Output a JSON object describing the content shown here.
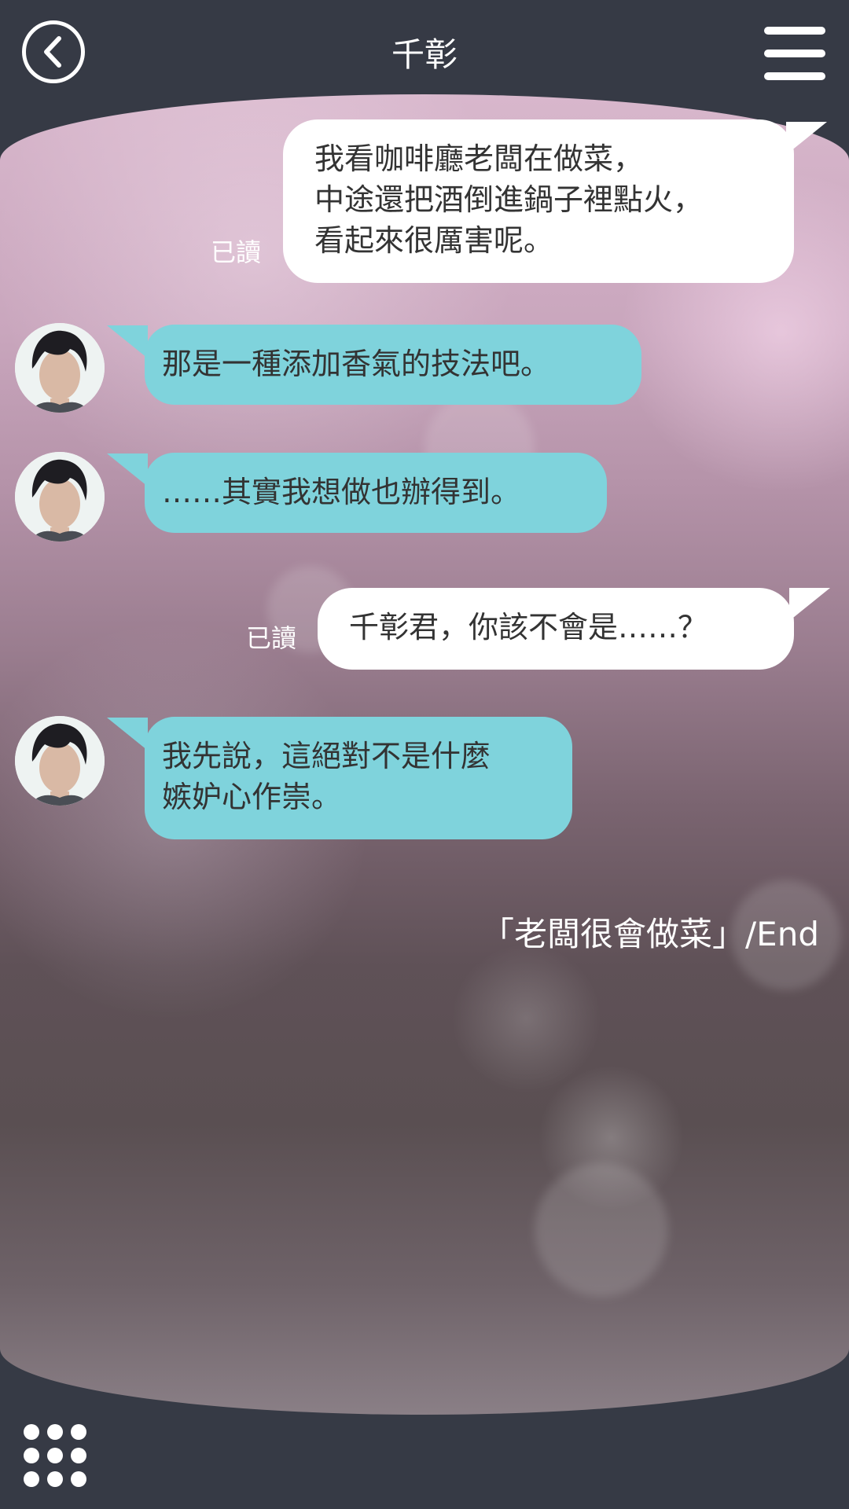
{
  "header": {
    "title": "千彰"
  },
  "messages": [
    {
      "sender": "me",
      "text": "我看咖啡廳老闆在做菜，\n中途還把酒倒進鍋子裡點火，\n看起來很厲害呢。",
      "read": "已讀"
    },
    {
      "sender": "them",
      "text": "那是一種添加香氣的技法吧。"
    },
    {
      "sender": "them",
      "text": "……其實我想做也辦得到。"
    },
    {
      "sender": "me",
      "text": "千彰君，你該不會是……？",
      "read": "已讀"
    },
    {
      "sender": "them",
      "text": "我先說，這絕對不是什麼\n嫉妒心作崇。"
    }
  ],
  "end_caption": "「老闆很會做菜」/End",
  "colors": {
    "chrome": "#363a45",
    "them_bubble": "#7fd3dc",
    "me_bubble": "#ffffff"
  },
  "icons": {
    "back": "back-arrow-icon",
    "menu": "hamburger-menu-icon",
    "grid": "grid-menu-icon"
  }
}
